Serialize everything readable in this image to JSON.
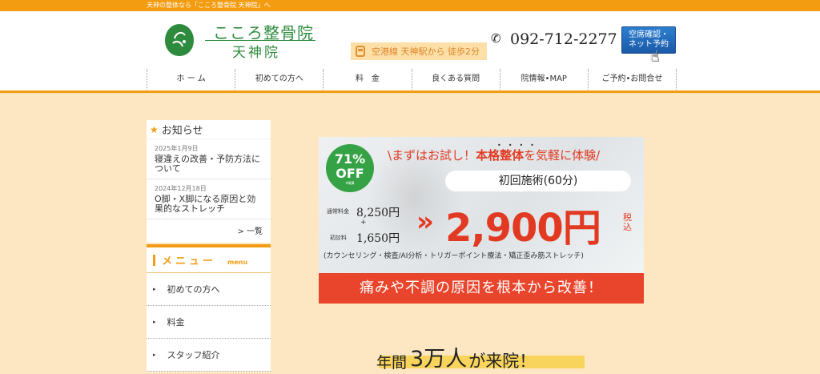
{
  "topbar": {
    "text": "天神の整体なら「こころ整骨院 天神院」へ"
  },
  "header": {
    "logo_name": "こころ整骨院",
    "logo_sub": "天神院",
    "access": "空港線 天神駅から 徒歩2分",
    "phone": "092-712-2277",
    "reserve_line1": "空席確認・",
    "reserve_line2": "ネット予約"
  },
  "nav": {
    "items": [
      {
        "label": "ホ ー ム"
      },
      {
        "label": "初めての方へ"
      },
      {
        "label": "料　金"
      },
      {
        "label": "良くある質問"
      },
      {
        "label": "院情報•MAP"
      },
      {
        "label": "ご予約•お問合せ"
      }
    ]
  },
  "news": {
    "title": "お知らせ",
    "items": [
      {
        "date": "2025年1月9日",
        "text": "寝違えの改善・予防方法について"
      },
      {
        "date": "2024年12月18日",
        "text": "O脚・X脚になる原因と効果的なストレッチ"
      }
    ],
    "more": "> 一覧"
  },
  "menu": {
    "title": "メニュー",
    "sub": "menu",
    "items": [
      {
        "label": "初めての方へ"
      },
      {
        "label": "料金"
      },
      {
        "label": "スタッフ紹介"
      }
    ]
  },
  "banner": {
    "badge_pct": "71%",
    "badge_off": "OFF",
    "badge_note": "※概算",
    "tagline_pre": "\\まずはお試し！",
    "tagline_bold": "本格整体",
    "tagline_post": "を気軽に体験/",
    "tagline_dots": "••••",
    "first_visit": "初回施術(60分)",
    "regular_label": "通常料金",
    "regular_price": "8,250円",
    "plus": "+",
    "initial_label": "初診料",
    "initial_price": "1,650円",
    "arrows": "»",
    "price": "2,900円",
    "tax": "税込",
    "course_note": "(カウンセリング・検査/AI分析・トリガーポイント療法・矯正歪み筋ストレッチ)",
    "strip": "痛みや不調の原因を根本から改善！"
  },
  "visitors": {
    "a": "年間",
    "b": "3万人",
    "c": "が来院！"
  },
  "colors": {
    "accent": "#f39c12",
    "brand_green": "#2e8b3e",
    "red": "#e23a22",
    "blue": "#1b5aa7"
  }
}
